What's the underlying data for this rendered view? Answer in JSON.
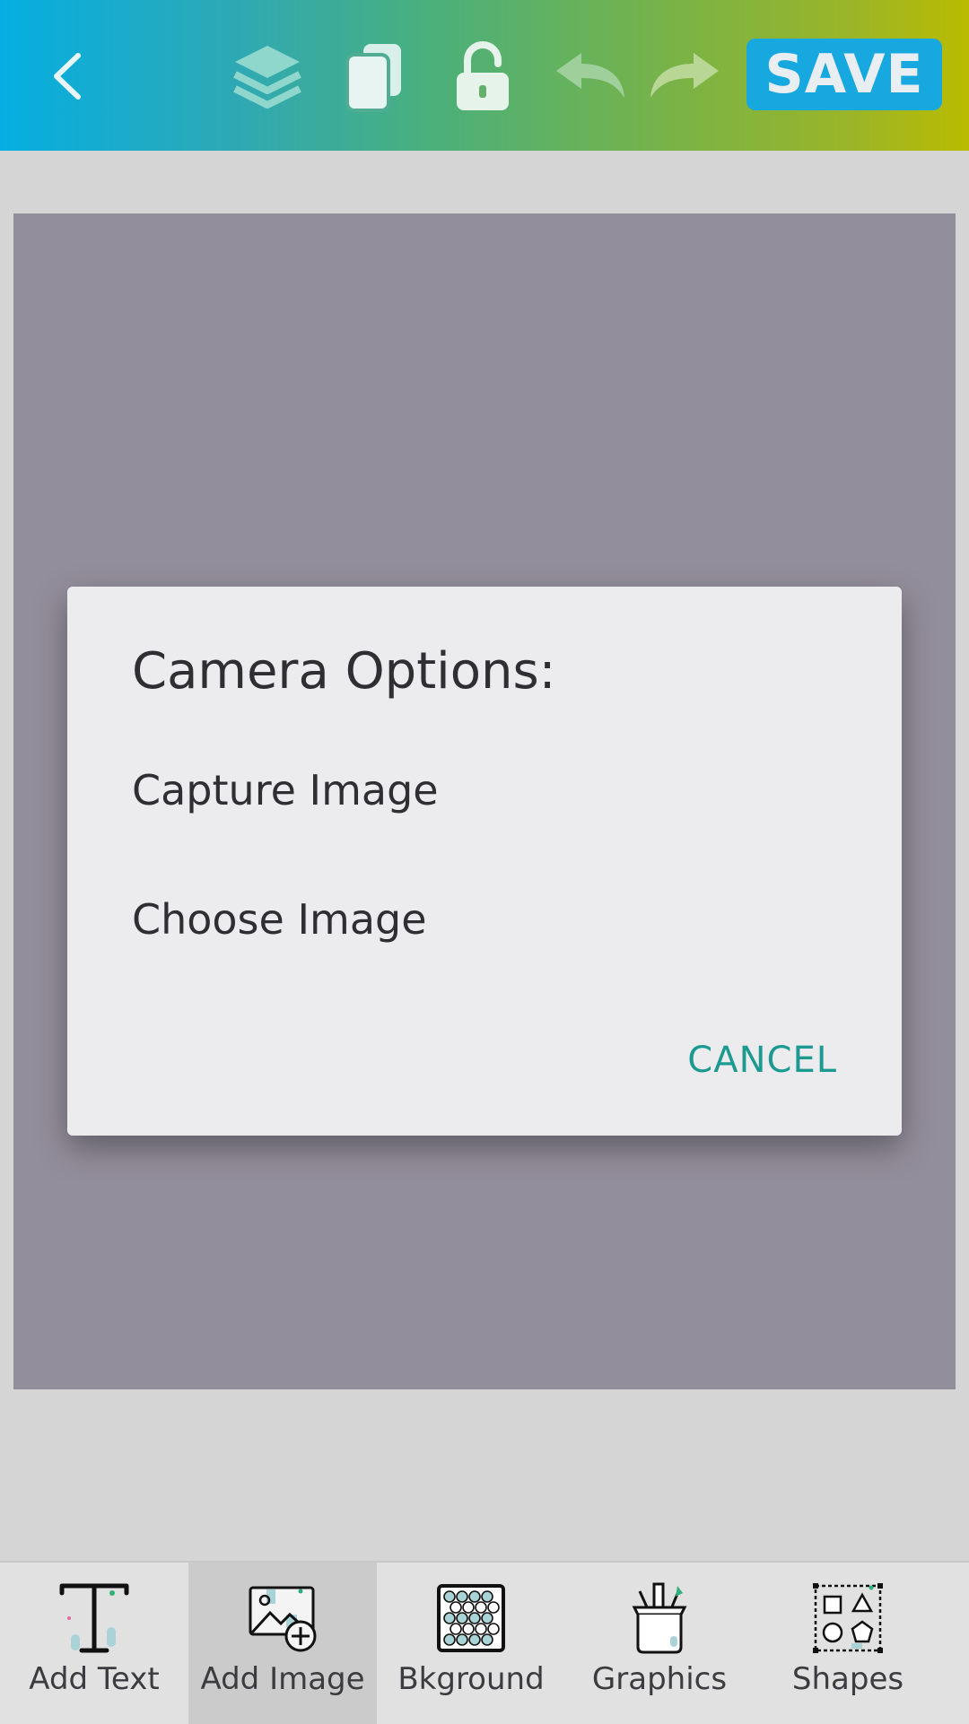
{
  "toolbar": {
    "back_icon": "chevron-left-icon",
    "layers_icon": "layers-icon",
    "duplicate_icon": "copy-icon",
    "lock_icon": "unlock-icon",
    "undo_icon": "undo-icon",
    "redo_icon": "redo-icon",
    "save_label": "SAVE",
    "accent_color": "#18a8e0"
  },
  "canvas": {
    "background_color": "#938e9b"
  },
  "dialog": {
    "title": "Camera Options:",
    "options": [
      "Capture Image",
      "Choose Image"
    ],
    "cancel_label": "CANCEL",
    "cancel_color": "#1c9a92"
  },
  "bottom_tools": [
    {
      "label": "Add Text",
      "icon": "text-icon",
      "active": false
    },
    {
      "label": "Add Image",
      "icon": "add-image-icon",
      "active": true
    },
    {
      "label": "Bkground",
      "icon": "background-pattern-icon",
      "active": false
    },
    {
      "label": "Graphics",
      "icon": "pencil-cup-icon",
      "active": false
    },
    {
      "label": "Shapes",
      "icon": "shapes-icon",
      "active": false
    }
  ]
}
